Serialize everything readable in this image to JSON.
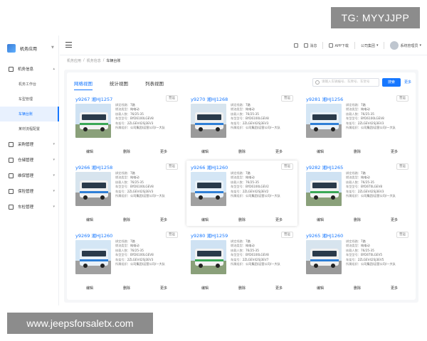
{
  "watermarks": {
    "top": "TG: MYYJJPP",
    "bottom": "www.jeepsforsaletx.com"
  },
  "brand": {
    "name": "机务应用"
  },
  "sidebar": {
    "groups": [
      {
        "label": "机务信息",
        "icon": "info-icon",
        "expanded": true,
        "items": [
          {
            "label": "机务工作台",
            "active": false
          },
          {
            "label": "车型管理",
            "active": false
          },
          {
            "label": "车辆台账",
            "active": true
          },
          {
            "label": "某材流程配置",
            "active": false
          }
        ]
      },
      {
        "label": "采购管理",
        "icon": "cart-icon"
      },
      {
        "label": "仓储管理",
        "icon": "warehouse-icon"
      },
      {
        "label": "维保管理",
        "icon": "wrench-icon"
      },
      {
        "label": "保险管理",
        "icon": "shield-icon"
      },
      {
        "label": "车检管理",
        "icon": "user-icon"
      }
    ]
  },
  "topbar": {
    "tools": [
      "消息",
      "APP下载",
      "公司集团"
    ],
    "user": "系统管理员"
  },
  "breadcrumb": [
    "机务应用",
    "机务信息",
    "车辆台账"
  ],
  "view_tabs": [
    {
      "label": "网格视图",
      "active": true
    },
    {
      "label": "统计视图",
      "active": false
    },
    {
      "label": "列表视图",
      "active": false
    }
  ],
  "search": {
    "placeholder": "请输入车辆编号、车牌号、车架号",
    "button": "搜索",
    "more": "更多"
  },
  "card_labels": {
    "route": "绑定线路：",
    "type": "燃油类型：",
    "seats": "核载人数：",
    "model": "车型型号：",
    "vin": "车架号：",
    "org": "所属组织：",
    "edit": "编辑",
    "delete": "删除",
    "more": "更多"
  },
  "cards": [
    {
      "id": "y9267 湘HJ1257",
      "status": "营运",
      "route": "7路",
      "fuel": "纯电动",
      "seats": "76/25-35",
      "model": "BYD6100LGEV8",
      "vin": "2ZLGEV42SJ3EV3",
      "org": "公司集团/运营公司/一大队"
    },
    {
      "id": "y9270 湘HJ1268",
      "status": "营运",
      "route": "7路",
      "fuel": "纯电动",
      "seats": "76/25-35",
      "model": "BYD6100LGEV8",
      "vin": "2ZLGEV42SJ3EV3",
      "org": "公司集团/运营公司/一大队"
    },
    {
      "id": "y9281 湘HJ1256",
      "status": "营运",
      "route": "7路",
      "fuel": "纯电动",
      "seats": "76/25-35",
      "model": "BYD6100LGEV8",
      "vin": "2ZLGEV42SJ3EV3",
      "org": "公司集团/运营公司/一大队"
    },
    {
      "id": "y9266 湘HJ1258",
      "status": "营运",
      "route": "7路",
      "fuel": "纯电动",
      "seats": "76/25-35",
      "model": "BYD6100LGEV8",
      "vin": "2ZLGEV42SJ3EV3",
      "org": "公司集团/运营公司/一大队"
    },
    {
      "id": "y9266 湘HJ1260",
      "status": "营运",
      "route": "7路",
      "fuel": "纯电动",
      "seats": "76/25-35",
      "model": "BYD6100LGEV2",
      "vin": "2ZLGEV42SJ3EV2",
      "org": "公司集团/运营公司/一大队"
    },
    {
      "id": "y9282 湘HJ1265",
      "status": "营运",
      "route": "7路",
      "fuel": "纯电动",
      "seats": "76/25-35",
      "model": "BYD6T0LGEV8",
      "vin": "2ZLGEV42SJ3EV3",
      "org": "公司集团/运营公司/一大队"
    },
    {
      "id": "y9269 湘HJ1260",
      "status": "营运",
      "route": "7路",
      "fuel": "纯电动",
      "seats": "76/25-35",
      "model": "BYD6100LGEV8",
      "vin": "2ZLGEV42SJ3EV3",
      "org": "公司集团/运营公司/一大队"
    },
    {
      "id": "y9280 湘HJ1259",
      "status": "营运",
      "route": "7路",
      "fuel": "纯电动",
      "seats": "76/25-35",
      "model": "BYD6100LGEV8",
      "vin": "2ZLGEV42SJ3EV7",
      "org": "公司集团/运营公司/一大队"
    },
    {
      "id": "y9265 湘HJ1260",
      "status": "营运",
      "route": "7路",
      "fuel": "纯电动",
      "seats": "76/25-35",
      "model": "BYD6T0LGEV5",
      "vin": "2ZLGEV42SJ3EV5",
      "org": "公司集团/运营公司/一大队"
    }
  ],
  "colors": {
    "accent": "#1677ff",
    "active_bg": "#e8f1fe",
    "bus_green": "#3aa856",
    "bus_blue": "#2f7fd6"
  }
}
